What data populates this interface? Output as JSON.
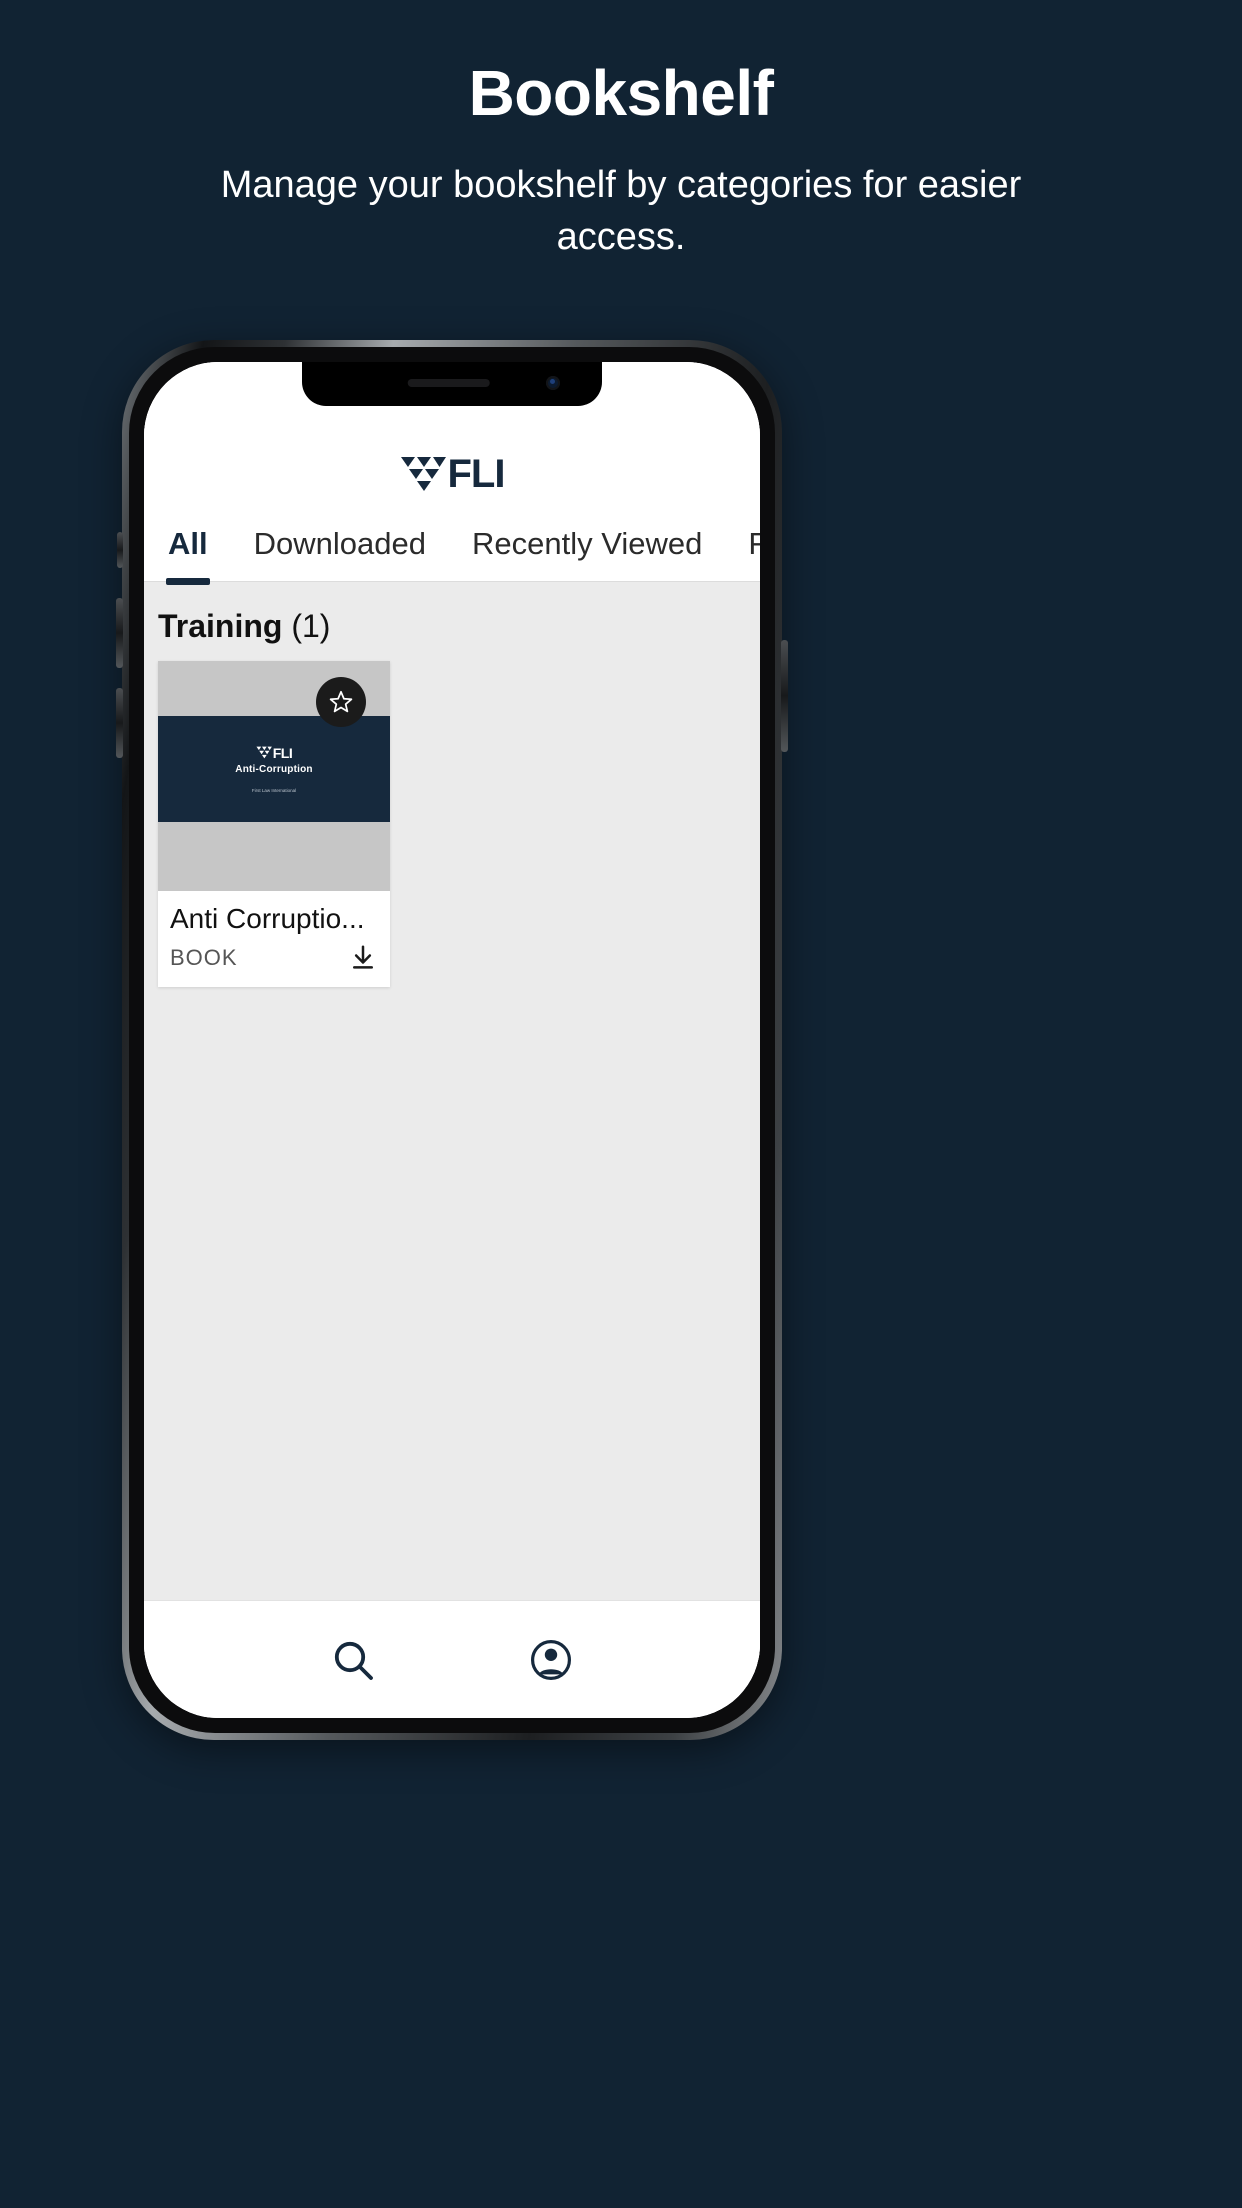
{
  "promo": {
    "title": "Bookshelf",
    "subtitle": "Manage your bookshelf by categories for easier access."
  },
  "colors": {
    "background": "#112333",
    "brand_navy": "#16293d",
    "content_bg": "#ebebeb",
    "thumb_gray": "#c6c6c6",
    "card_white": "#ffffff"
  },
  "app": {
    "logo_text": "FLI",
    "tabs": [
      {
        "label": "All",
        "active": true
      },
      {
        "label": "Downloaded",
        "active": false
      },
      {
        "label": "Recently Viewed",
        "active": false
      },
      {
        "label": "Favou",
        "active": false
      }
    ],
    "section": {
      "name": "Training",
      "count": "(1)"
    },
    "books": [
      {
        "title": "Anti Corruptio...",
        "type": "BOOK",
        "cover_logo_text": "FLI",
        "cover_title": "Anti-Corruption",
        "cover_footer": "First Law International",
        "favorite_icon": "star-icon",
        "download_icon": "download-icon"
      }
    ],
    "bottom_nav": [
      {
        "icon": "search-icon",
        "label": "Search"
      },
      {
        "icon": "profile-icon",
        "label": "Profile"
      }
    ]
  }
}
